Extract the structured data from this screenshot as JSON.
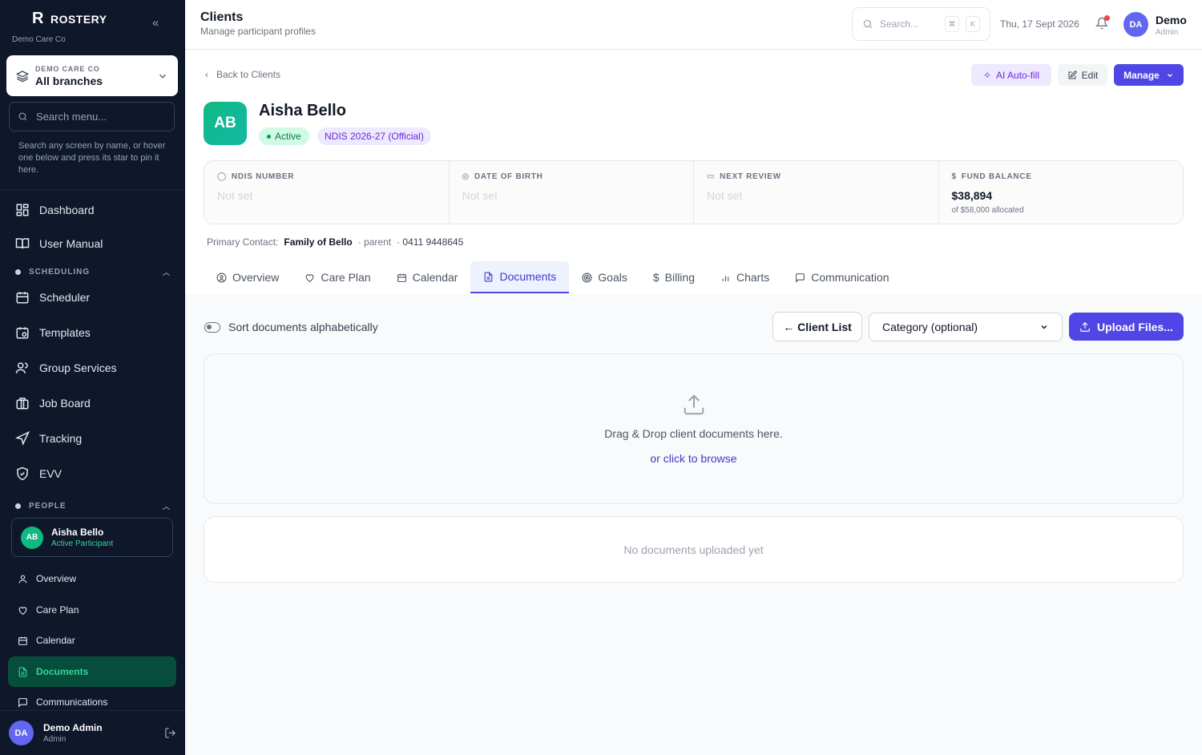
{
  "brand": {
    "name": "ROSTERY",
    "org": "Demo Care Co"
  },
  "branch": {
    "org_label": "DEMO CARE CO",
    "value": "All branches"
  },
  "sidebar_search": {
    "placeholder": "Search menu...",
    "help": "Search any screen by name, or hover one below and press its star to pin it here."
  },
  "nav": {
    "dashboard": "Dashboard",
    "user_manual": "User Manual",
    "scheduling_header": "SCHEDULING",
    "scheduler": "Scheduler",
    "templates": "Templates",
    "group_services": "Group Services",
    "job_board": "Job Board",
    "tracking": "Tracking",
    "evv": "EVV",
    "people_header": "PEOPLE"
  },
  "client_card": {
    "initials": "AB",
    "name": "Aisha Bello",
    "status": "Active Participant"
  },
  "client_subnav": {
    "overview": "Overview",
    "care_plan": "Care Plan",
    "calendar": "Calendar",
    "documents": "Documents",
    "communications": "Communications"
  },
  "footer_user": {
    "initials": "DA",
    "name": "Demo Admin",
    "role": "Admin"
  },
  "topbar": {
    "title": "Clients",
    "subtitle": "Manage participant profiles",
    "search_placeholder": "Search...",
    "kbd1": "⌘",
    "kbd2": "K",
    "date": "Thu, 17 Sept 2026",
    "user_initials": "DA",
    "user_name": "Demo",
    "user_role": "Admin"
  },
  "profile": {
    "back": "Back to Clients",
    "ai_autofill": "AI Auto-fill",
    "edit": "Edit",
    "manage": "Manage",
    "initials": "AB",
    "name": "Aisha Bello",
    "status": "Active",
    "plan": "NDIS 2026-27 (Official)"
  },
  "stats": {
    "ndis_label": "NDIS NUMBER",
    "ndis_value": "Not set",
    "dob_label": "DATE OF BIRTH",
    "dob_value": "Not set",
    "review_label": "NEXT REVIEW",
    "review_value": "Not set",
    "fund_label": "FUND BALANCE",
    "fund_value": "$38,894",
    "fund_note": "of $58,000 allocated"
  },
  "contact": {
    "label": "Primary Contact:",
    "name": "Family of Bello",
    "relation": "· parent",
    "phone": "· 0411 9448645"
  },
  "tabs": {
    "overview": "Overview",
    "care_plan": "Care Plan",
    "calendar": "Calendar",
    "documents": "Documents",
    "goals": "Goals",
    "billing": "Billing",
    "charts": "Charts",
    "communication": "Communication"
  },
  "documents": {
    "sort_label": "Sort documents alphabetically",
    "client_list": "← Client List",
    "category": "Category (optional)",
    "upload": "Upload Files...",
    "drop_text": "Drag & Drop client documents here.",
    "browse": "or click to browse",
    "empty": "No documents uploaded yet"
  }
}
